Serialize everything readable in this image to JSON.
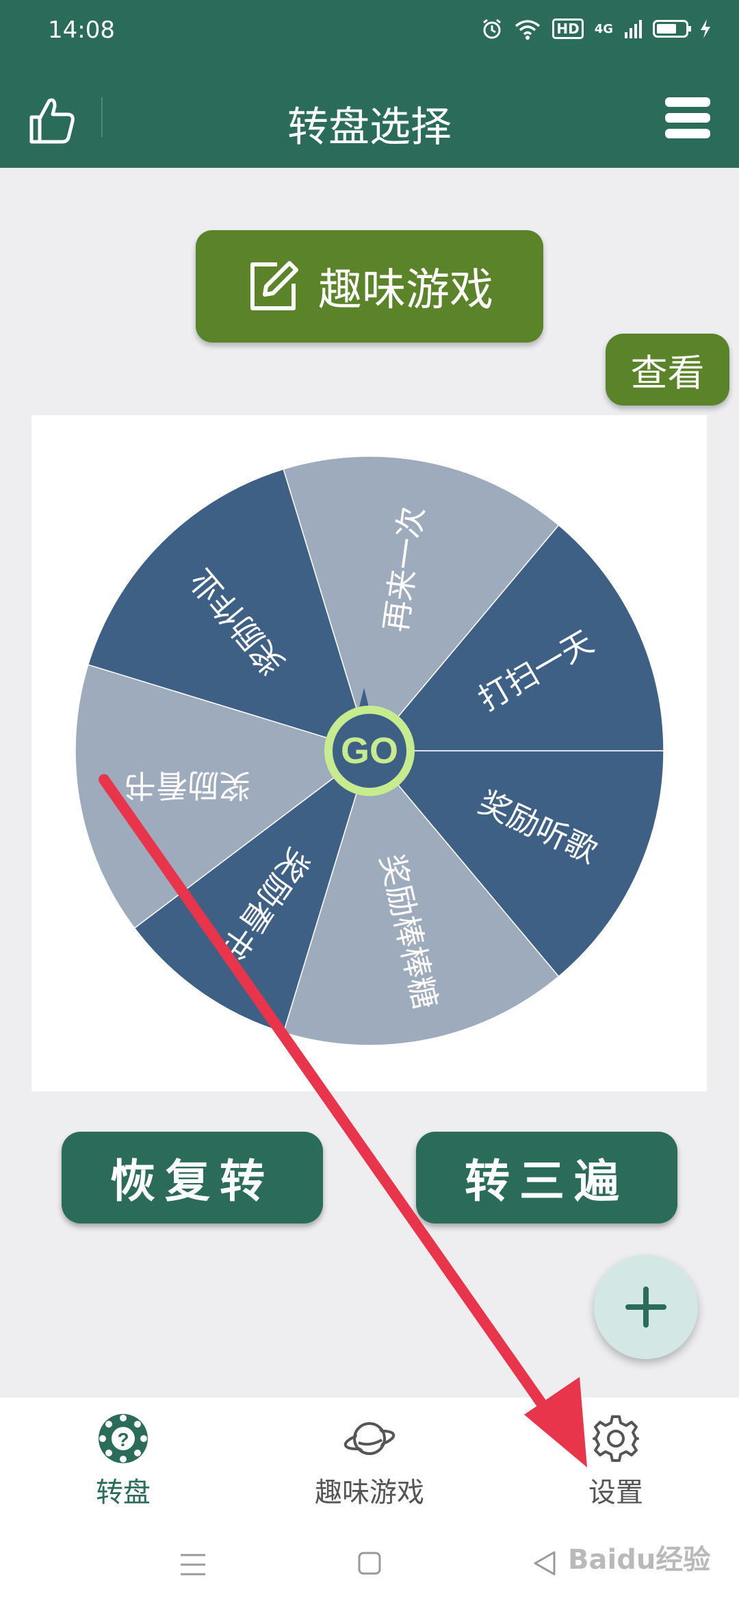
{
  "status_bar": {
    "time": "14:08",
    "network": "4G",
    "hd": "HD"
  },
  "header": {
    "title": "转盘选择"
  },
  "category_button": {
    "label": "趣味游戏"
  },
  "view_button": {
    "label": "查看"
  },
  "wheel": {
    "center_label": "GO",
    "segments": [
      "打扫一天",
      "奖励听歌",
      "奖励棒棒糖",
      "奖励看书",
      "奖励看书",
      "奖励作业",
      "再来一次"
    ]
  },
  "actions": {
    "restore": "恢复转",
    "spin_three": "转三遍"
  },
  "bottom_nav": [
    {
      "label": "转盘",
      "icon": "wheel-icon",
      "active": true
    },
    {
      "label": "趣味游戏",
      "icon": "planet-icon",
      "active": false
    },
    {
      "label": "设置",
      "icon": "gear-icon",
      "active": false
    }
  ],
  "watermark": "Baidu经验",
  "colors": {
    "primary": "#2a6b5a",
    "accent_green": "#5a832a",
    "segment_dark": "#3f6085",
    "segment_light": "#9eabbc",
    "hub_ring": "#c7ec8f",
    "arrow": "#e8354b"
  }
}
